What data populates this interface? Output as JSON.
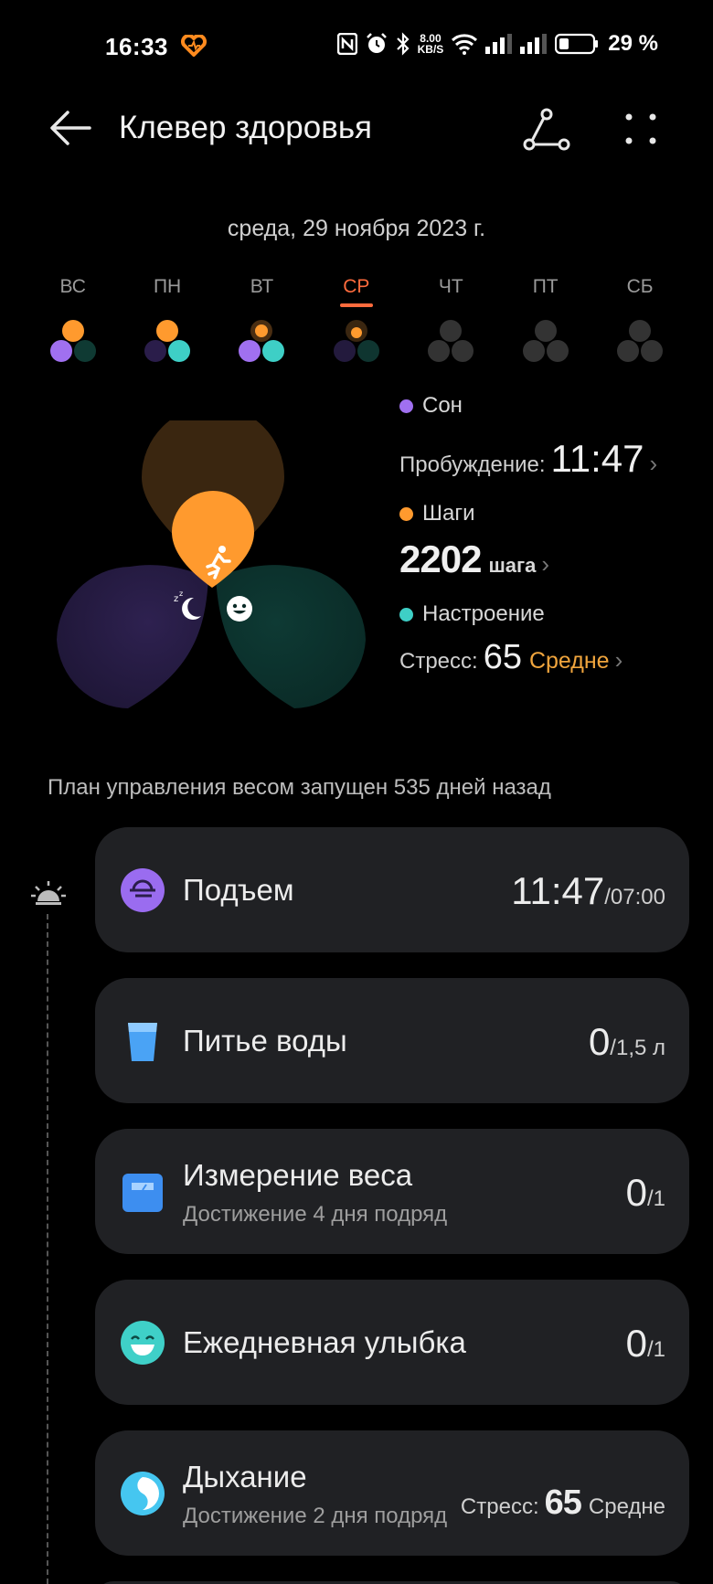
{
  "status_bar": {
    "time": "16:33",
    "net_speed_value": "8.00",
    "net_speed_unit": "KB/S",
    "battery": "29 %"
  },
  "header": {
    "title": "Клевер здоровья"
  },
  "date": "среда, 29 ноября 2023 г.",
  "week": {
    "days": [
      "ВС",
      "ПН",
      "ВТ",
      "СР",
      "ЧТ",
      "ПТ",
      "СБ"
    ],
    "active_index": 3
  },
  "colors": {
    "sleep": "#a070f0",
    "steps": "#ff9a2e",
    "mood": "#3ecfc6",
    "inactive": "#333333",
    "accent": "#ff6b3d",
    "stress_level": "#f0a53d"
  },
  "stats": {
    "sleep_label": "Сон",
    "wake_label": "Пробуждение:",
    "wake_time": "11:47",
    "steps_label": "Шаги",
    "steps_value": "2202",
    "steps_unit": "шага",
    "mood_label": "Настроение",
    "stress_label": "Стресс:",
    "stress_value": "65",
    "stress_level": "Средне"
  },
  "plan_note": "План управления весом запущен 535 дней назад",
  "tasks": [
    {
      "icon": "wake-up-icon",
      "title": "Подъем",
      "value": "11:47",
      "goal": "/07:00"
    },
    {
      "icon": "water-glass-icon",
      "title": "Питье воды",
      "value": "0",
      "goal": "/1,5 л"
    },
    {
      "icon": "scale-icon",
      "title": "Измерение веса",
      "subtitle": "Достижение 4 дня подряд",
      "value": "0",
      "goal": "/1"
    },
    {
      "icon": "smile-icon",
      "title": "Ежедневная улыбка",
      "value": "0",
      "goal": "/1"
    },
    {
      "icon": "breathing-icon",
      "title": "Дыхание",
      "subtitle": "Достижение 2 дня подряд",
      "stress_label": "Стресс:",
      "value": "65",
      "level": "Средне"
    }
  ]
}
